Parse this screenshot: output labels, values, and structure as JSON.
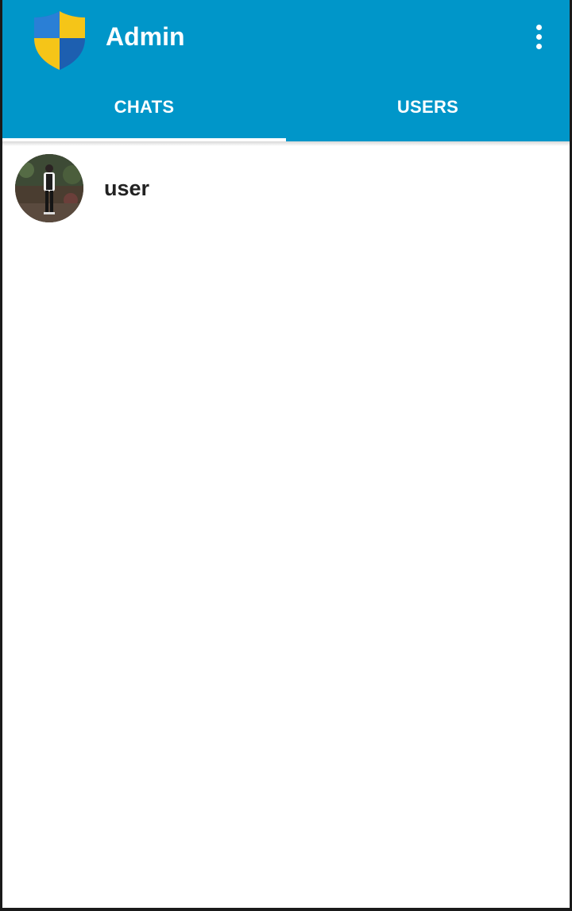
{
  "appbar": {
    "title": "Admin",
    "logo_icon": "shield-icon",
    "overflow_icon": "more-vert-icon",
    "background": "#0096c9"
  },
  "tabs": [
    {
      "label": "CHATS",
      "active": true
    },
    {
      "label": "USERS",
      "active": false
    }
  ],
  "chats": [
    {
      "name": "user",
      "avatar_icon": "avatar-photo"
    }
  ],
  "colors": {
    "shield_blue": "#1e6fc8",
    "shield_yellow": "#f5c518"
  }
}
